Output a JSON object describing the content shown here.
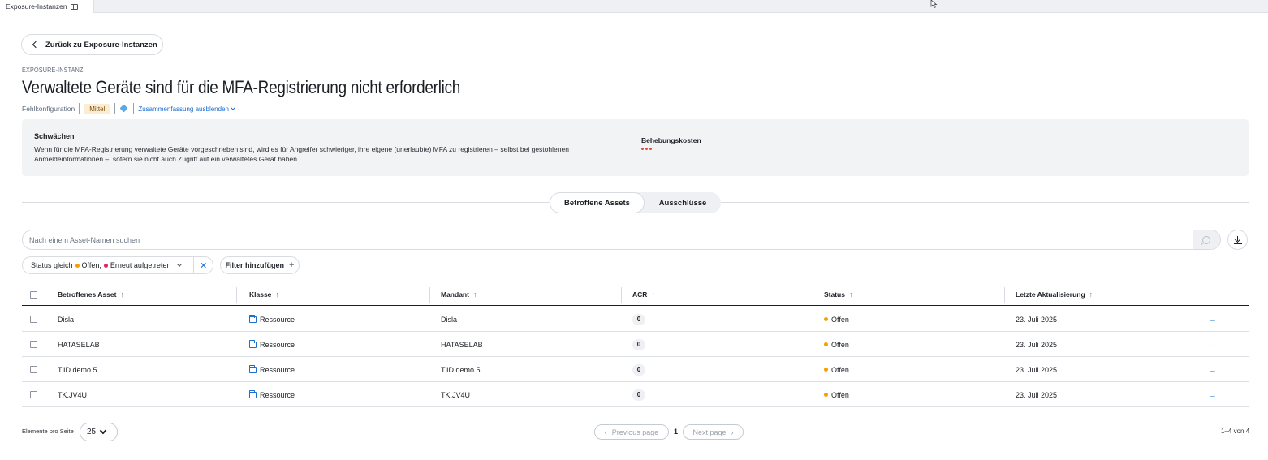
{
  "tab": {
    "title": "Exposure-Instanzen"
  },
  "header": {
    "back_label": "Zurück zu Exposure-Instanzen",
    "overline": "EXPOSURE-INSTANZ",
    "title": "Verwaltete Geräte sind für die MFA-Registrierung nicht erforderlich",
    "category": "Fehlkonfiguration",
    "severity": "Mittel",
    "summary_toggle": "Zusammenfassung ausblenden"
  },
  "summary": {
    "title": "Schwächen",
    "text": "Wenn für die MFA-Registrierung verwaltete Geräte vorgeschrieben sind, wird es für Angreifer schwieriger, ihre eigene (unerlaubte) MFA zu registrieren – selbst bei gestohlenen Anmeldeinformationen –, sofern sie nicht auch Zugriff auf ein verwaltetes Gerät haben.",
    "cost_label": "Behebungskosten"
  },
  "tabs": [
    {
      "label": "Betroffene Assets",
      "active": true
    },
    {
      "label": "Ausschlüsse",
      "active": false
    }
  ],
  "search": {
    "placeholder": "Nach einem Asset-Namen suchen"
  },
  "filter": {
    "prefix": "Status gleich",
    "value1": "Offen,",
    "value2": "Erneut aufgetreten",
    "add_label": "Filter hinzufügen"
  },
  "table": {
    "columns": [
      "Betroffenes Asset",
      "Klasse",
      "Mandant",
      "ACR",
      "Status",
      "Letzte Aktualisierung"
    ],
    "rows": [
      {
        "asset": "Disla",
        "klasse": "Ressource",
        "mandant": "Disla",
        "acr": "0",
        "status": "Offen",
        "updated": "23. Juli 2025"
      },
      {
        "asset": "HATASELAB",
        "klasse": "Ressource",
        "mandant": "HATASELAB",
        "acr": "0",
        "status": "Offen",
        "updated": "23. Juli 2025"
      },
      {
        "asset": "T.ID demo 5",
        "klasse": "Ressource",
        "mandant": "T.ID demo 5",
        "acr": "0",
        "status": "Offen",
        "updated": "23. Juli 2025"
      },
      {
        "asset": "TK.JV4U",
        "klasse": "Ressource",
        "mandant": "TK.JV4U",
        "acr": "0",
        "status": "Offen",
        "updated": "23. Juli 2025"
      }
    ]
  },
  "pagination": {
    "per_page_label": "Elemente pro Seite",
    "per_page_value": "25",
    "prev_label": "Previous page",
    "page": "1",
    "next_label": "Next page",
    "count": "1–4 von 4"
  },
  "colors": {
    "accent": "#1c6fd1",
    "status_open": "#f5a000",
    "status_reopened": "#e0245e",
    "severity_bg": "#fbecd2"
  }
}
